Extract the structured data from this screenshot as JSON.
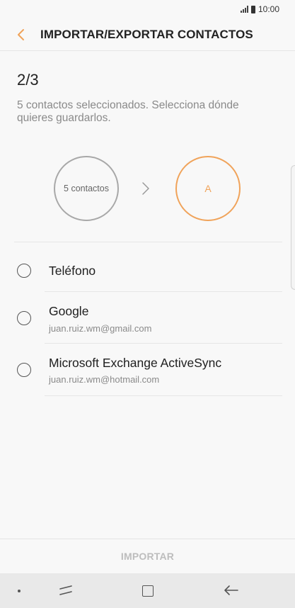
{
  "status": {
    "time": "10:00"
  },
  "header": {
    "title": "IMPORTAR/EXPORTAR CONTACTOS"
  },
  "step": {
    "label": "2/3",
    "description": "5 contactos seleccionados. Selecciona dónde quieres guardarlos."
  },
  "flow": {
    "source_label": "5 contactos",
    "destination_label": "A"
  },
  "options": [
    {
      "label": "Teléfono",
      "sub": ""
    },
    {
      "label": "Google",
      "sub": "juan.ruiz.wm@gmail.com"
    },
    {
      "label": "Microsoft Exchange ActiveSync",
      "sub": "juan.ruiz.wm@hotmail.com"
    }
  ],
  "footer": {
    "button_label": "IMPORTAR"
  },
  "colors": {
    "accent": "#f0a35a",
    "text_secondary": "#8a8a8a",
    "disabled": "#bdbdbd"
  },
  "icons": [
    "signal-icon",
    "battery-icon",
    "back-arrow-icon",
    "chevron-right-icon",
    "radio-icon",
    "recents-icon",
    "home-icon",
    "nav-back-icon"
  ]
}
